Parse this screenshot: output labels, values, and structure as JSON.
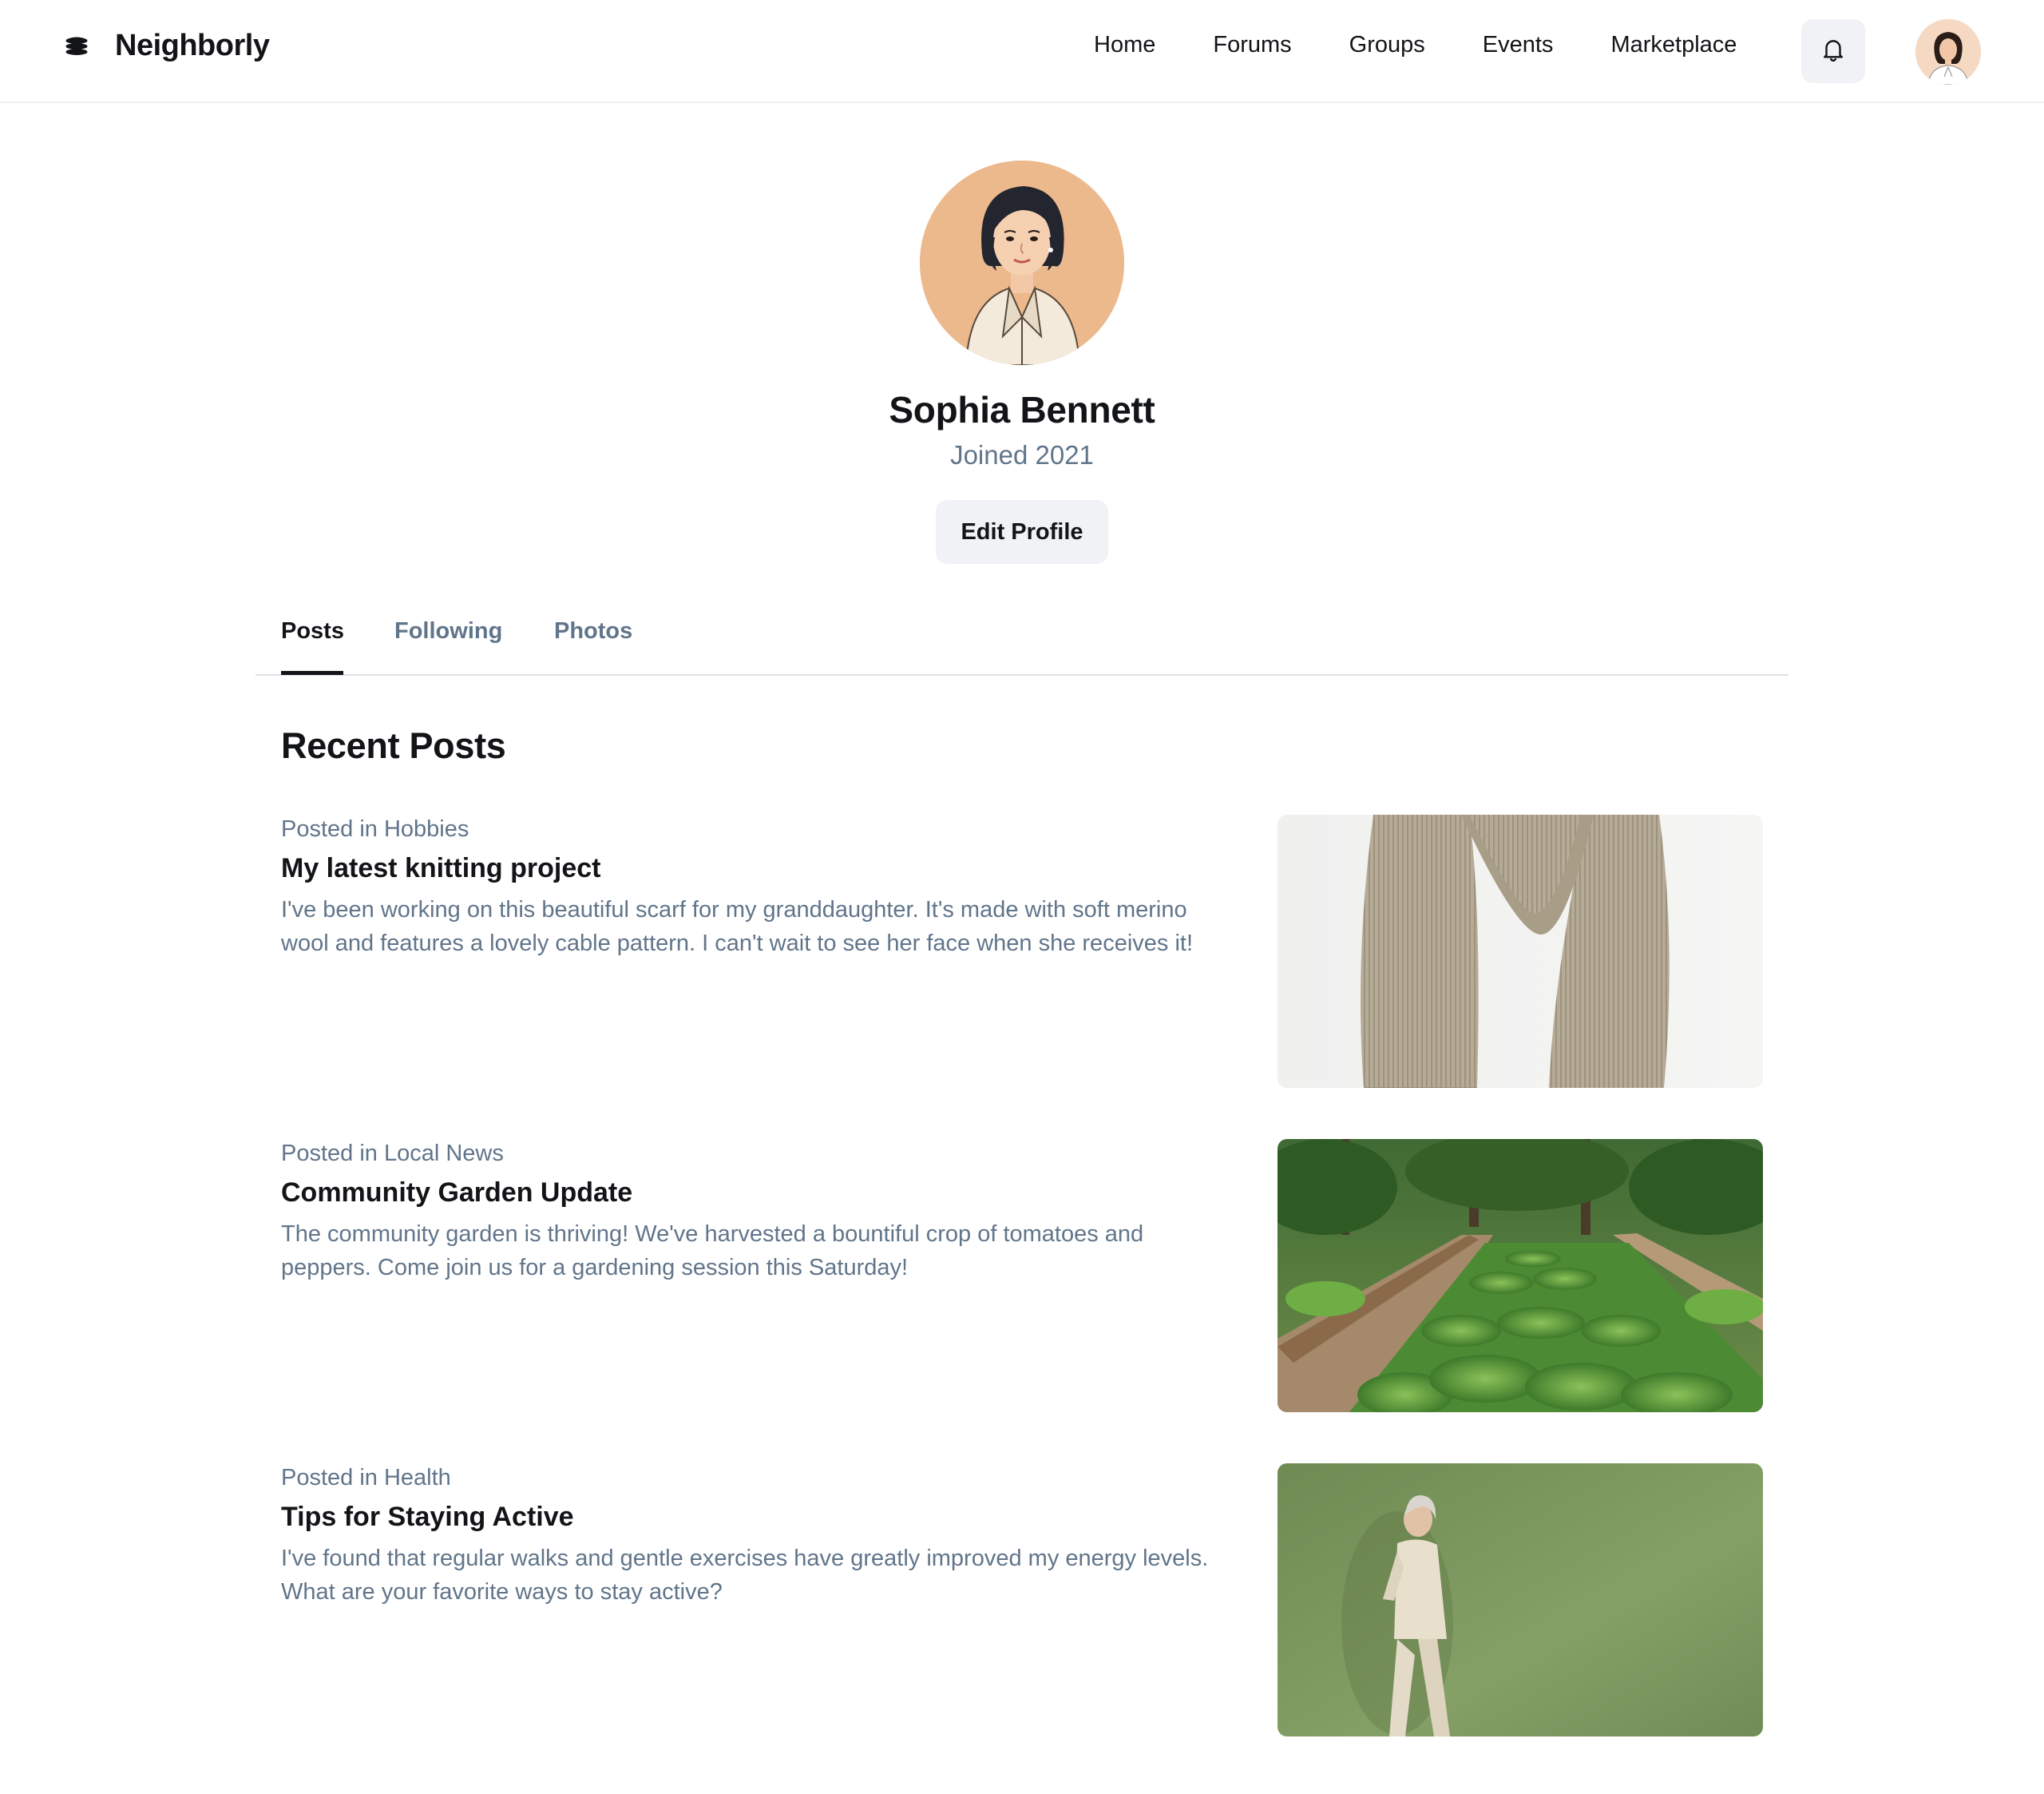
{
  "app": {
    "brand": "Neighborly",
    "logo_icon": "stack-logo-icon"
  },
  "nav": {
    "items": [
      "Home",
      "Forums",
      "Groups",
      "Events",
      "Marketplace"
    ],
    "notifications_icon": "bell-icon",
    "user_avatar": "user-avatar"
  },
  "profile": {
    "name": "Sophia Bennett",
    "joined": "Joined 2021",
    "edit_label": "Edit Profile",
    "avatar_bg": "#ecb98d"
  },
  "tabs": {
    "items": [
      "Posts",
      "Following",
      "Photos"
    ],
    "active": "Posts"
  },
  "posts_section": {
    "title": "Recent Posts",
    "posts": [
      {
        "meta": "Posted in Hobbies",
        "title": "My latest knitting project",
        "body": "I've been working on this beautiful scarf for my granddaughter. It's made with soft merino wool and features a lovely cable pattern. I can't wait to see her face when she receives it!",
        "image": "knitted-scarf-photo"
      },
      {
        "meta": "Posted in Local News",
        "title": "Community Garden Update",
        "body": "The community garden is thriving! We've harvested a bountiful crop of tomatoes and peppers. Come join us for a gardening session this Saturday!",
        "image": "community-garden-photo"
      },
      {
        "meta": "Posted in Health",
        "title": "Tips for Staying Active",
        "body": "I've found that regular walks and gentle exercises have greatly improved my energy levels. What are your favorite ways to stay active?",
        "image": "elderly-woman-walking-photo"
      }
    ]
  },
  "colors": {
    "text_primary": "#121417",
    "text_secondary": "#61758a",
    "button_bg": "#f0f2f5",
    "divider": "#dbe0e5"
  }
}
